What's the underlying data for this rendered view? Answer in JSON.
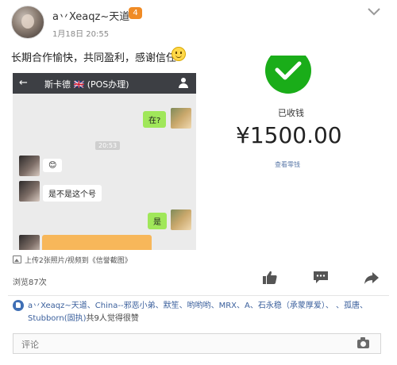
{
  "post": {
    "username": "a丷Xeaqz~天道",
    "level_badge": "4",
    "timestamp": "1月18日 20:55",
    "text": "长期合作愉快，共同盈利，感谢信任",
    "emoji_icon": "smile-icon"
  },
  "chat_image": {
    "back_glyph": "←",
    "title": "斯卡德 🇬🇧 (POS办理)",
    "messages": [
      "在?",
      "20:53",
      "😊",
      "是不是这个号",
      "是"
    ]
  },
  "payment_image": {
    "status": "已收钱",
    "amount": "¥1500.00",
    "link": "查看零钱",
    "accent": "#1aad19"
  },
  "attachment_note": "上传2张照片/视频到《信誉截图》",
  "views": "浏览87次",
  "likes": {
    "names": "a丷Xeaqz~天道、China--邪恶小弟、默笙、哟哟哟、MRX、A、石永稳（承蒙厚爱）、       、孤唐、Stubborn(固执)",
    "suffix": "共9人觉得很赞"
  },
  "comment": {
    "placeholder": "评论"
  }
}
